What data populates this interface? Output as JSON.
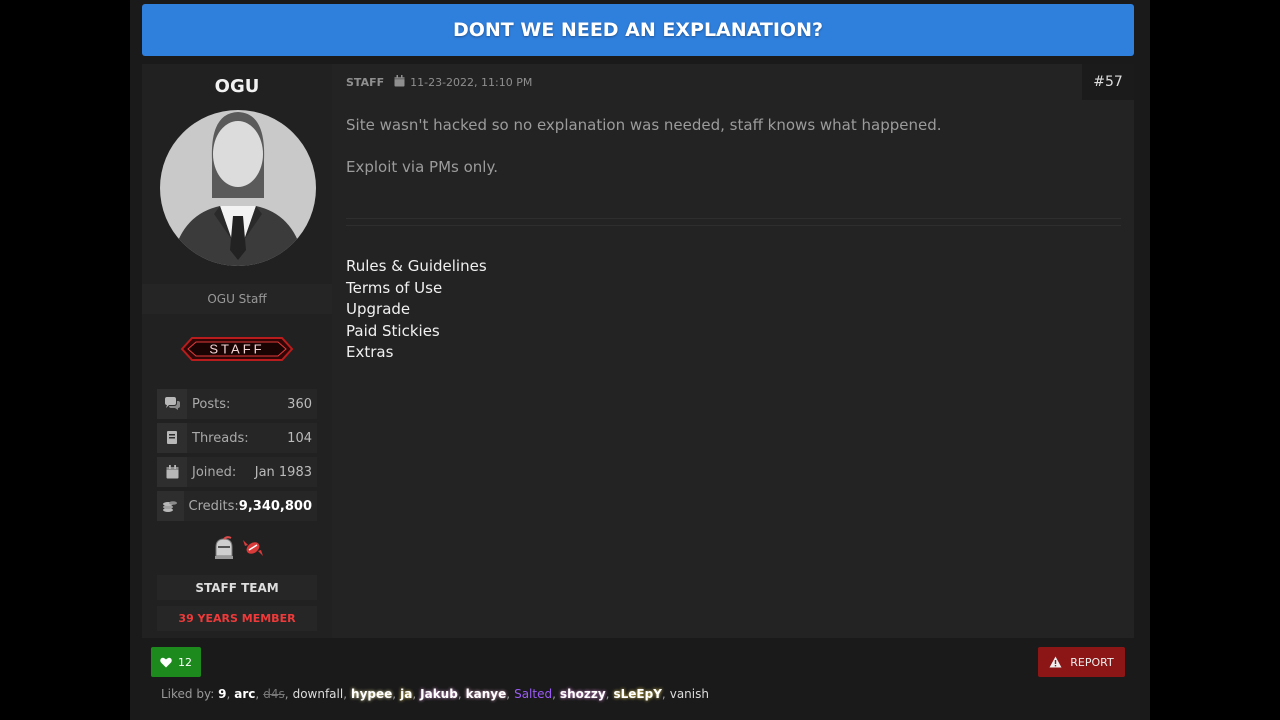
{
  "thread": {
    "title": "DONT WE NEED AN EXPLANATION?"
  },
  "user": {
    "name": "OGU",
    "title": "OGU Staff",
    "badge": "STAFF",
    "stats": [
      {
        "icon": "posts-icon",
        "label": "Posts:",
        "value": "360"
      },
      {
        "icon": "threads-icon",
        "label": "Threads:",
        "value": "104"
      },
      {
        "icon": "calendar-icon",
        "label": "Joined:",
        "value": "Jan 1983"
      },
      {
        "icon": "coins-icon",
        "label": "Credits:",
        "value": "9,340,800"
      }
    ],
    "team": "STAFF TEAM",
    "member_duration": "39 YEARS MEMBER"
  },
  "post": {
    "role": "STAFF",
    "datetime": "11-23-2022, 11:10 PM",
    "number": "#57",
    "paragraphs": [
      "Site wasn't hacked so no explanation was needed, staff knows what happened.",
      "Exploit via PMs only."
    ],
    "signature_links": [
      "Rules & Guidelines",
      "Terms of Use",
      "Upgrade",
      "Paid Stickies",
      "Extras"
    ]
  },
  "actions": {
    "like_count": "12",
    "report_label": "REPORT"
  },
  "liked_by": {
    "label": "Liked by:",
    "names": [
      "9",
      "arc",
      "d4s",
      "downfall",
      "hypee",
      "ja",
      "Jakub",
      "kanye",
      "Salted",
      "shozzy",
      "sLeEpY",
      "vanish"
    ]
  },
  "colors": {
    "title_bar": "#2f7fdd",
    "like_green": "#1d8a1d",
    "report_red": "#8c1616",
    "member_red": "#ee3a3a",
    "salted_purple": "#9b5cf6"
  }
}
